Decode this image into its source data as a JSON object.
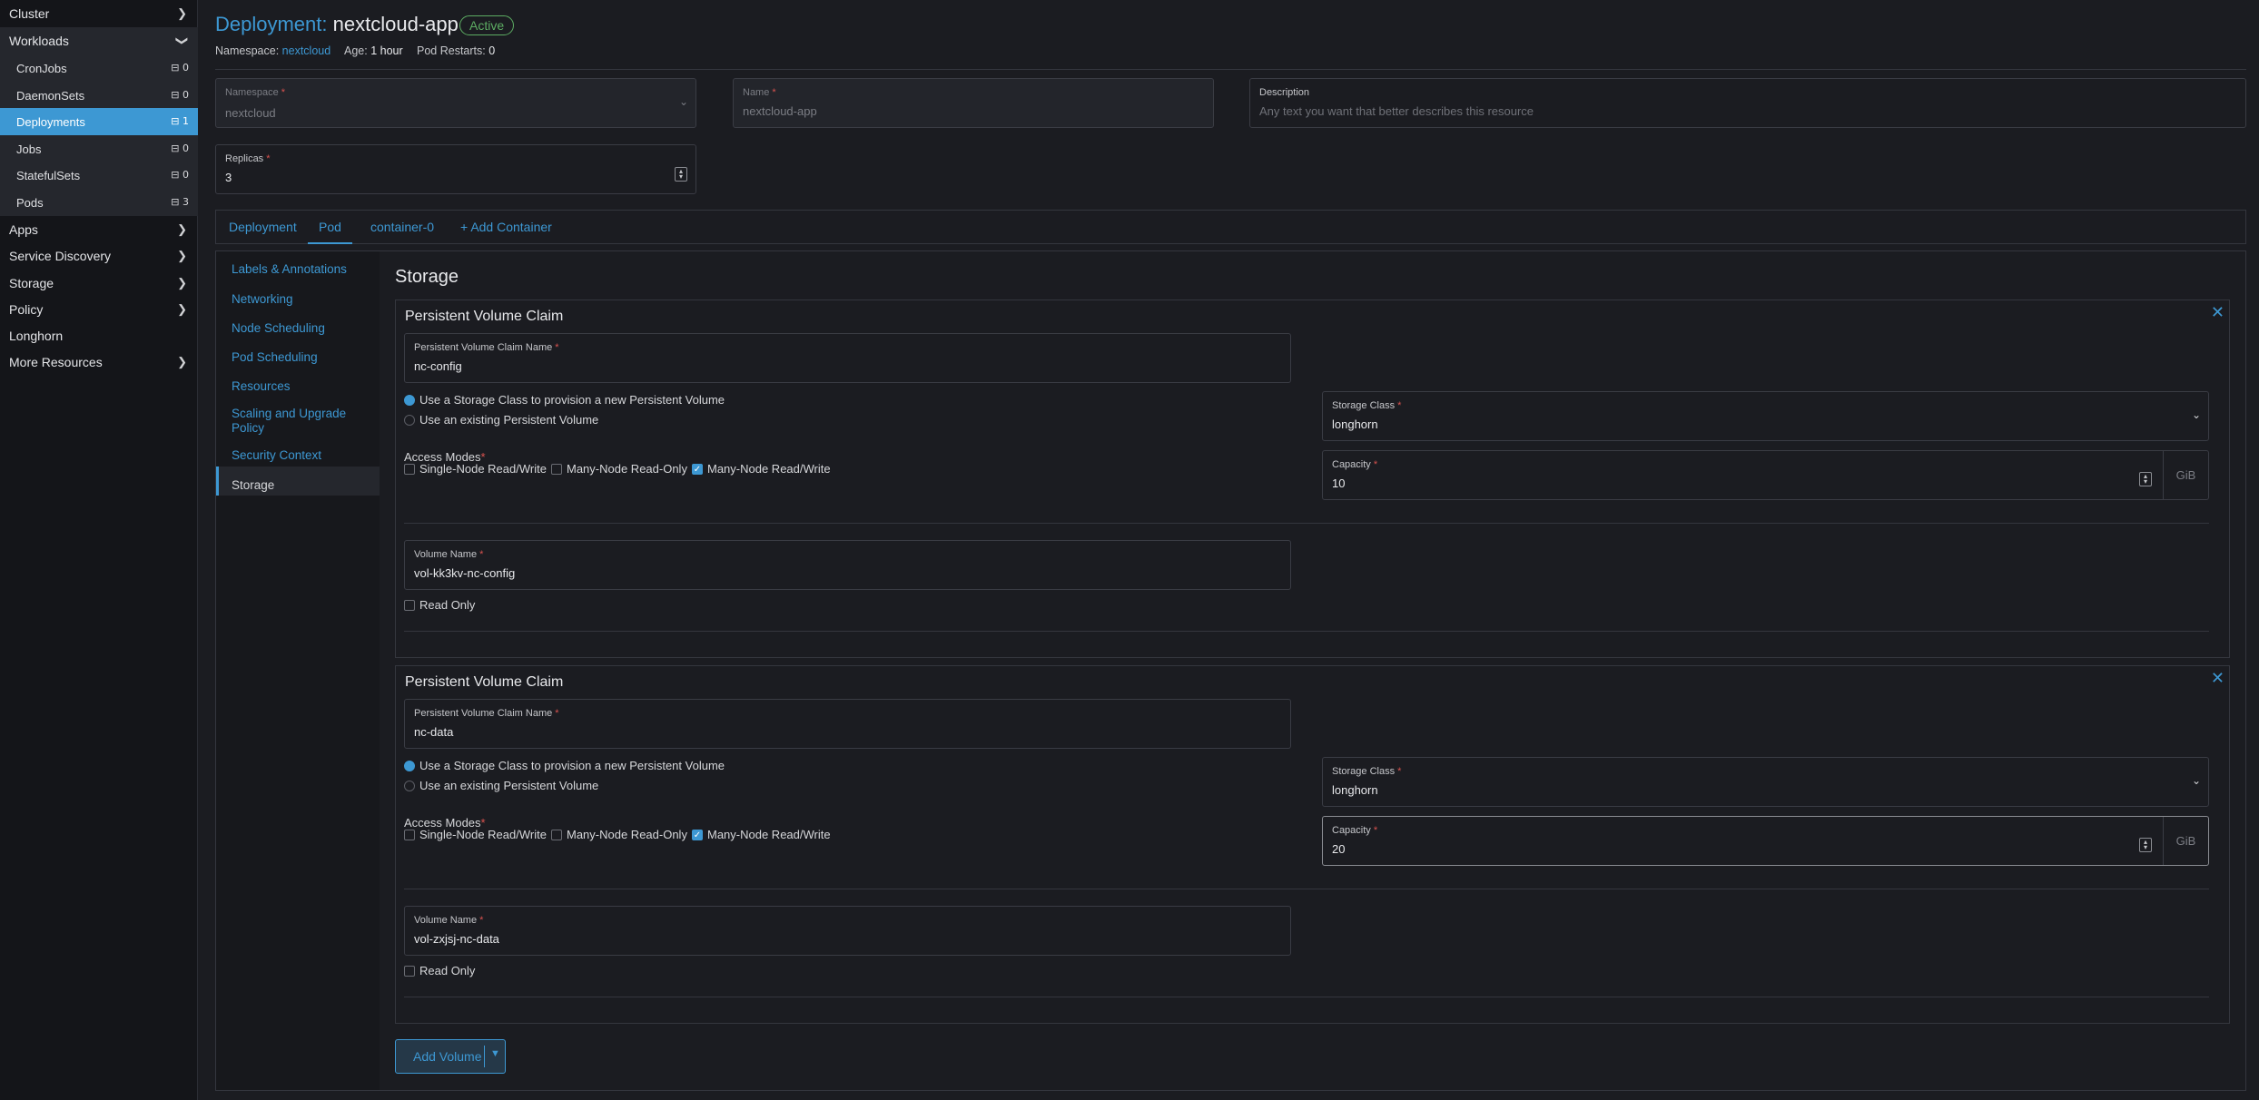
{
  "sidebar": {
    "groups": [
      {
        "label": "Cluster",
        "icon": "chevron-right-icon"
      },
      {
        "label": "Workloads",
        "icon": "chevron-down-icon"
      },
      {
        "label": "Apps",
        "icon": "chevron-right-icon"
      },
      {
        "label": "Service Discovery",
        "icon": "chevron-right-icon"
      },
      {
        "label": "Storage",
        "icon": "chevron-right-icon"
      },
      {
        "label": "Policy",
        "icon": "chevron-right-icon"
      },
      {
        "label": "Longhorn"
      },
      {
        "label": "More Resources",
        "icon": "chevron-right-icon"
      }
    ],
    "workloads": [
      {
        "label": "CronJobs",
        "count": "0"
      },
      {
        "label": "DaemonSets",
        "count": "0"
      },
      {
        "label": "Deployments",
        "count": "1",
        "active": true
      },
      {
        "label": "Jobs",
        "count": "0"
      },
      {
        "label": "StatefulSets",
        "count": "0"
      },
      {
        "label": "Pods",
        "count": "3"
      }
    ]
  },
  "header": {
    "kind": "Deployment:",
    "name": "nextcloud-app",
    "status": "Active",
    "namespace_label": "Namespace:",
    "namespace": "nextcloud",
    "age_label": "Age:",
    "age": "1 hour",
    "restarts_label": "Pod Restarts:",
    "restarts": "0"
  },
  "form": {
    "namespace": {
      "label": "Namespace",
      "value": "nextcloud"
    },
    "name": {
      "label": "Name",
      "value": "nextcloud-app"
    },
    "description": {
      "label": "Description",
      "placeholder": "Any text you want that better describes this resource"
    },
    "replicas": {
      "label": "Replicas",
      "value": "3"
    }
  },
  "tabs": [
    "Deployment",
    "Pod",
    "container-0",
    "Add Container"
  ],
  "side_tabs": [
    "Labels & Annotations",
    "Networking",
    "Node Scheduling",
    "Pod Scheduling",
    "Resources",
    "Scaling and Upgrade",
    "Policy",
    "Security Context",
    "Storage"
  ],
  "storage": {
    "title": "Storage",
    "claims": [
      {
        "title": "Persistent Volume Claim",
        "pvc_label": "Persistent Volume Claim Name",
        "pvc_name": "nc-config",
        "radio_new": "Use a Storage Class to provision a new Persistent Volume",
        "radio_existing": "Use an existing Persistent Volume",
        "storage_class_label": "Storage Class",
        "storage_class": "longhorn",
        "access_label": "Access Modes",
        "access": [
          "Single-Node Read/Write",
          "Many-Node Read-Only",
          "Many-Node Read/Write"
        ],
        "capacity_label": "Capacity",
        "capacity": "10",
        "unit": "GiB",
        "volume_label": "Volume Name",
        "volume_name": "vol-kk3kv-nc-config",
        "read_only": "Read Only"
      },
      {
        "title": "Persistent Volume Claim",
        "pvc_label": "Persistent Volume Claim Name",
        "pvc_name": "nc-data",
        "radio_new": "Use a Storage Class to provision a new Persistent Volume",
        "radio_existing": "Use an existing Persistent Volume",
        "storage_class_label": "Storage Class",
        "storage_class": "longhorn",
        "access_label": "Access Modes",
        "access": [
          "Single-Node Read/Write",
          "Many-Node Read-Only",
          "Many-Node Read/Write"
        ],
        "capacity_label": "Capacity",
        "capacity": "20",
        "unit": "GiB",
        "volume_label": "Volume Name",
        "volume_name": "vol-zxjsj-nc-data",
        "read_only": "Read Only"
      }
    ],
    "add_volume": "Add Volume"
  },
  "colors": {
    "accent": "#3d98d3",
    "active_badge": "#5dad63",
    "background": "#1b1c21"
  }
}
